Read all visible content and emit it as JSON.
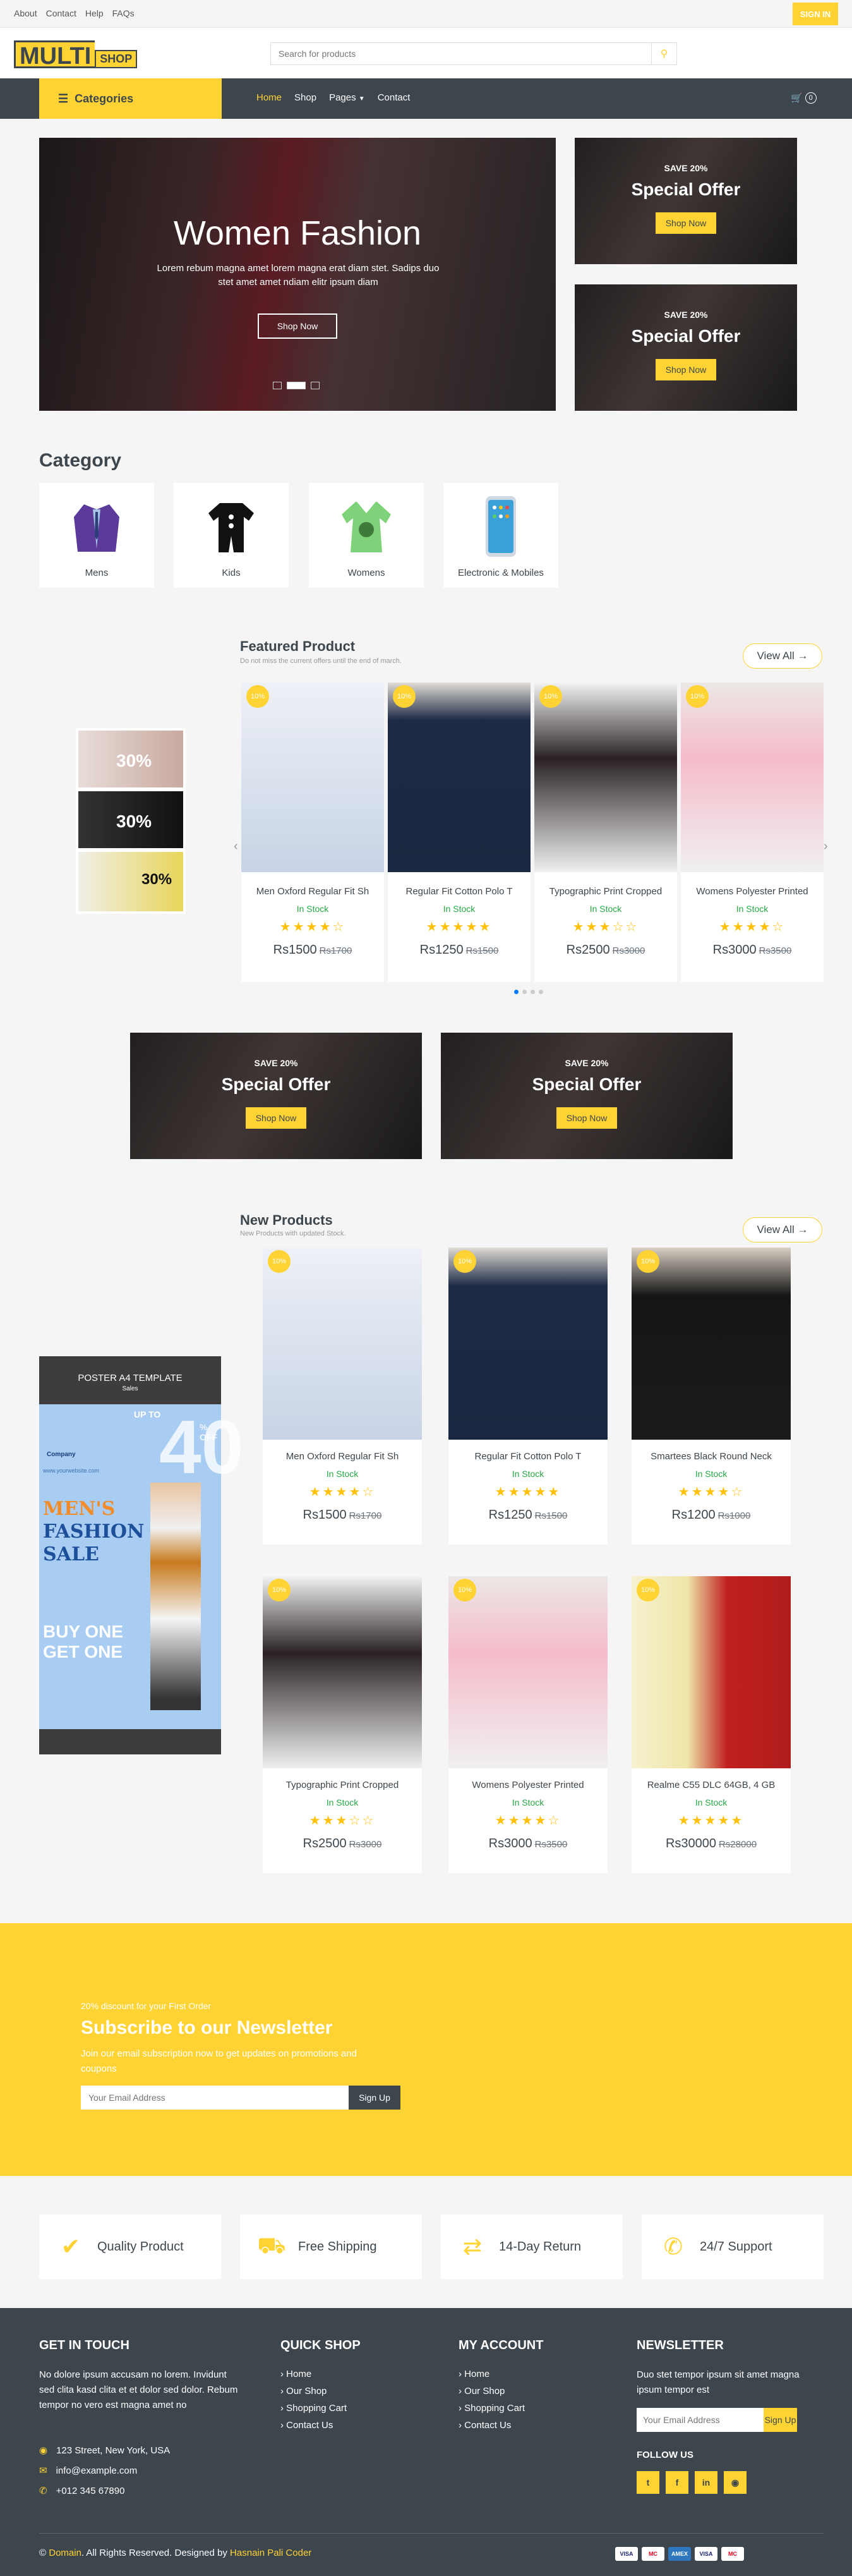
{
  "topbar": {
    "links": [
      "About",
      "Contact",
      "Help",
      "FAQs"
    ],
    "signin": "SIGN IN"
  },
  "logo": {
    "part1": "MULTI",
    "part2": "SHOP"
  },
  "search": {
    "placeholder": "Search for products"
  },
  "nav": {
    "categories": "Categories",
    "links": [
      "Home",
      "Shop",
      "Pages",
      "Contact"
    ],
    "cart_count": "0"
  },
  "hero": {
    "title": "Women Fashion",
    "text": "Lorem rebum magna amet lorem magna erat diam stet. Sadips duo stet amet amet ndiam elitr ipsum diam",
    "button": "Shop Now"
  },
  "offers": [
    {
      "save": "SAVE 20%",
      "title": "Special Offer",
      "button": "Shop Now"
    },
    {
      "save": "SAVE 20%",
      "title": "Special Offer",
      "button": "Shop Now"
    }
  ],
  "category": {
    "title": "Category",
    "items": [
      "Mens",
      "Kids",
      "Womens",
      "Electronic & Mobiles"
    ]
  },
  "featured": {
    "title": "Featured Product",
    "subtitle": "Do not miss the current offers until the end of march.",
    "view_all": "View All →",
    "banner_text": [
      "30%",
      "30%",
      "30%"
    ],
    "products": [
      {
        "badge": "10%",
        "name": "Men Oxford Regular Fit Sh",
        "stock": "In Stock",
        "stars": "★★★★☆",
        "price": "Rs1500",
        "old": "Rs1700"
      },
      {
        "badge": "10%",
        "name": "Regular Fit Cotton Polo T",
        "stock": "In Stock",
        "stars": "★★★★★",
        "price": "Rs1250",
        "old": "Rs1500"
      },
      {
        "badge": "10%",
        "name": "Typographic Print Cropped",
        "stock": "In Stock",
        "stars": "★★★☆☆",
        "price": "Rs2500",
        "old": "Rs3000"
      },
      {
        "badge": "10%",
        "name": "Womens Polyester Printed",
        "stock": "In Stock",
        "stars": "★★★★☆",
        "price": "Rs3000",
        "old": "Rs3500"
      }
    ]
  },
  "offers2": [
    {
      "save": "SAVE 20%",
      "title": "Special Offer",
      "button": "Shop Now"
    },
    {
      "save": "SAVE 20%",
      "title": "Special Offer",
      "button": "Shop Now"
    }
  ],
  "new_products": {
    "title": "New Products",
    "subtitle": "New Products with updated Stock.",
    "view_all": "View All →",
    "poster": {
      "head": "POSTER A4 TEMPLATE",
      "sub": "Sales",
      "upto": "UP TO",
      "pct": "40",
      "off": "% OFF",
      "company": "Company",
      "site": "www.yourwebsite.com",
      "sale1": "MEN'S",
      "sale2": "FASHION",
      "sale3": "SALE",
      "buy1": "BUY ONE",
      "buy2": "GET ONE"
    },
    "products": [
      {
        "badge": "10%",
        "name": "Men Oxford Regular Fit Sh",
        "stock": "In Stock",
        "stars": "★★★★☆",
        "price": "Rs1500",
        "old": "Rs1700"
      },
      {
        "badge": "10%",
        "name": "Regular Fit Cotton Polo T",
        "stock": "In Stock",
        "stars": "★★★★★",
        "price": "Rs1250",
        "old": "Rs1500"
      },
      {
        "badge": "10%",
        "name": "Smartees Black Round Neck",
        "stock": "In Stock",
        "stars": "★★★★☆",
        "price": "Rs1200",
        "old": "Rs1000"
      },
      {
        "badge": "10%",
        "name": "Typographic Print Cropped",
        "stock": "In Stock",
        "stars": "★★★☆☆",
        "price": "Rs2500",
        "old": "Rs3000"
      },
      {
        "badge": "10%",
        "name": "Womens Polyester Printed",
        "stock": "In Stock",
        "stars": "★★★★☆",
        "price": "Rs3000",
        "old": "Rs3500"
      },
      {
        "badge": "10%",
        "name": "Realme C55 DLC 64GB, 4 GB",
        "stock": "In Stock",
        "stars": "★★★★★",
        "price": "Rs30000",
        "old": "Rs28000"
      }
    ]
  },
  "newsletter": {
    "pre": "20% discount for your First Order",
    "title": "Subscribe to our Newsletter",
    "text": "Join our email subscription now to get updates on promotions and coupons",
    "placeholder": "Your Email Address",
    "button": "Sign Up"
  },
  "features": [
    "Quality Product",
    "Free Shipping",
    "14-Day Return",
    "24/7 Support"
  ],
  "footer": {
    "contact": {
      "title": "GET IN TOUCH",
      "text": "No dolore ipsum accusam no lorem. Invidunt sed clita kasd clita et et dolor sed dolor. Rebum tempor no vero est magna amet no",
      "address": "123 Street, New York, USA",
      "email": "info@example.com",
      "phone": "+012 345 67890"
    },
    "quick": {
      "title": "QUICK SHOP",
      "links": [
        "Home",
        "Our Shop",
        "Shopping Cart",
        "Contact Us"
      ]
    },
    "account": {
      "title": "MY ACCOUNT",
      "links": [
        "Home",
        "Our Shop",
        "Shopping Cart",
        "Contact Us"
      ]
    },
    "newsletter": {
      "title": "NEWSLETTER",
      "text": "Duo stet tempor ipsum sit amet magna ipsum tempor est",
      "placeholder": "Your Email Address",
      "button": "Sign Up",
      "follow": "FOLLOW US"
    },
    "copyright": {
      "pre": "© ",
      "domain": "Domain",
      "mid": ". All Rights Reserved. Designed by ",
      "designer": "Hasnain Pali Coder"
    },
    "payments": [
      "VISA",
      "MC",
      "AMEX",
      "VISA",
      "MC"
    ]
  }
}
